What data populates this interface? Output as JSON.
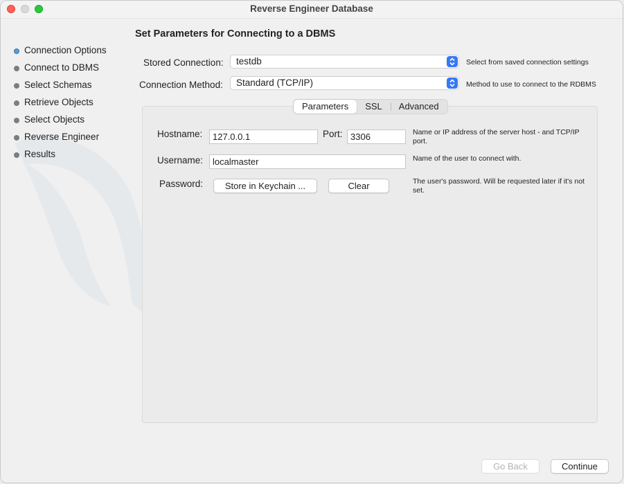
{
  "window": {
    "title": "Reverse Engineer Database"
  },
  "steps": [
    {
      "label": "Connection Options",
      "current": true
    },
    {
      "label": "Connect to DBMS",
      "current": false
    },
    {
      "label": "Select Schemas",
      "current": false
    },
    {
      "label": "Retrieve Objects",
      "current": false
    },
    {
      "label": "Select Objects",
      "current": false
    },
    {
      "label": "Reverse Engineer",
      "current": false
    },
    {
      "label": "Results",
      "current": false
    }
  ],
  "page": {
    "heading": "Set Parameters for Connecting to a DBMS"
  },
  "stored_connection": {
    "label": "Stored Connection:",
    "value": "testdb",
    "hint": "Select from saved connection settings"
  },
  "connection_method": {
    "label": "Connection Method:",
    "value": "Standard (TCP/IP)",
    "hint": "Method to use to connect to the RDBMS"
  },
  "tabs": [
    {
      "label": "Parameters",
      "active": true
    },
    {
      "label": "SSL",
      "active": false
    },
    {
      "label": "Advanced",
      "active": false
    }
  ],
  "params": {
    "hostname_label": "Hostname:",
    "hostname_value": "127.0.0.1",
    "port_label": "Port:",
    "port_value": "3306",
    "hostname_hint": "Name or IP address of the server host - and TCP/IP port.",
    "username_label": "Username:",
    "username_value": "localmaster",
    "username_hint": "Name of the user to connect with.",
    "password_label": "Password:",
    "store_keychain_label": "Store in Keychain ...",
    "clear_label": "Clear",
    "password_hint": "The user's password. Will be requested later if it's not set."
  },
  "footer": {
    "back_label": "Go Back",
    "continue_label": "Continue"
  },
  "colors": {
    "accent": "#3478f6",
    "close": "#ff5f57",
    "maximize": "#28c840"
  },
  "icons": [
    "close-icon",
    "minimize-icon",
    "maximize-icon",
    "dolphin-watermark-icon",
    "updown-chevron-icon"
  ]
}
